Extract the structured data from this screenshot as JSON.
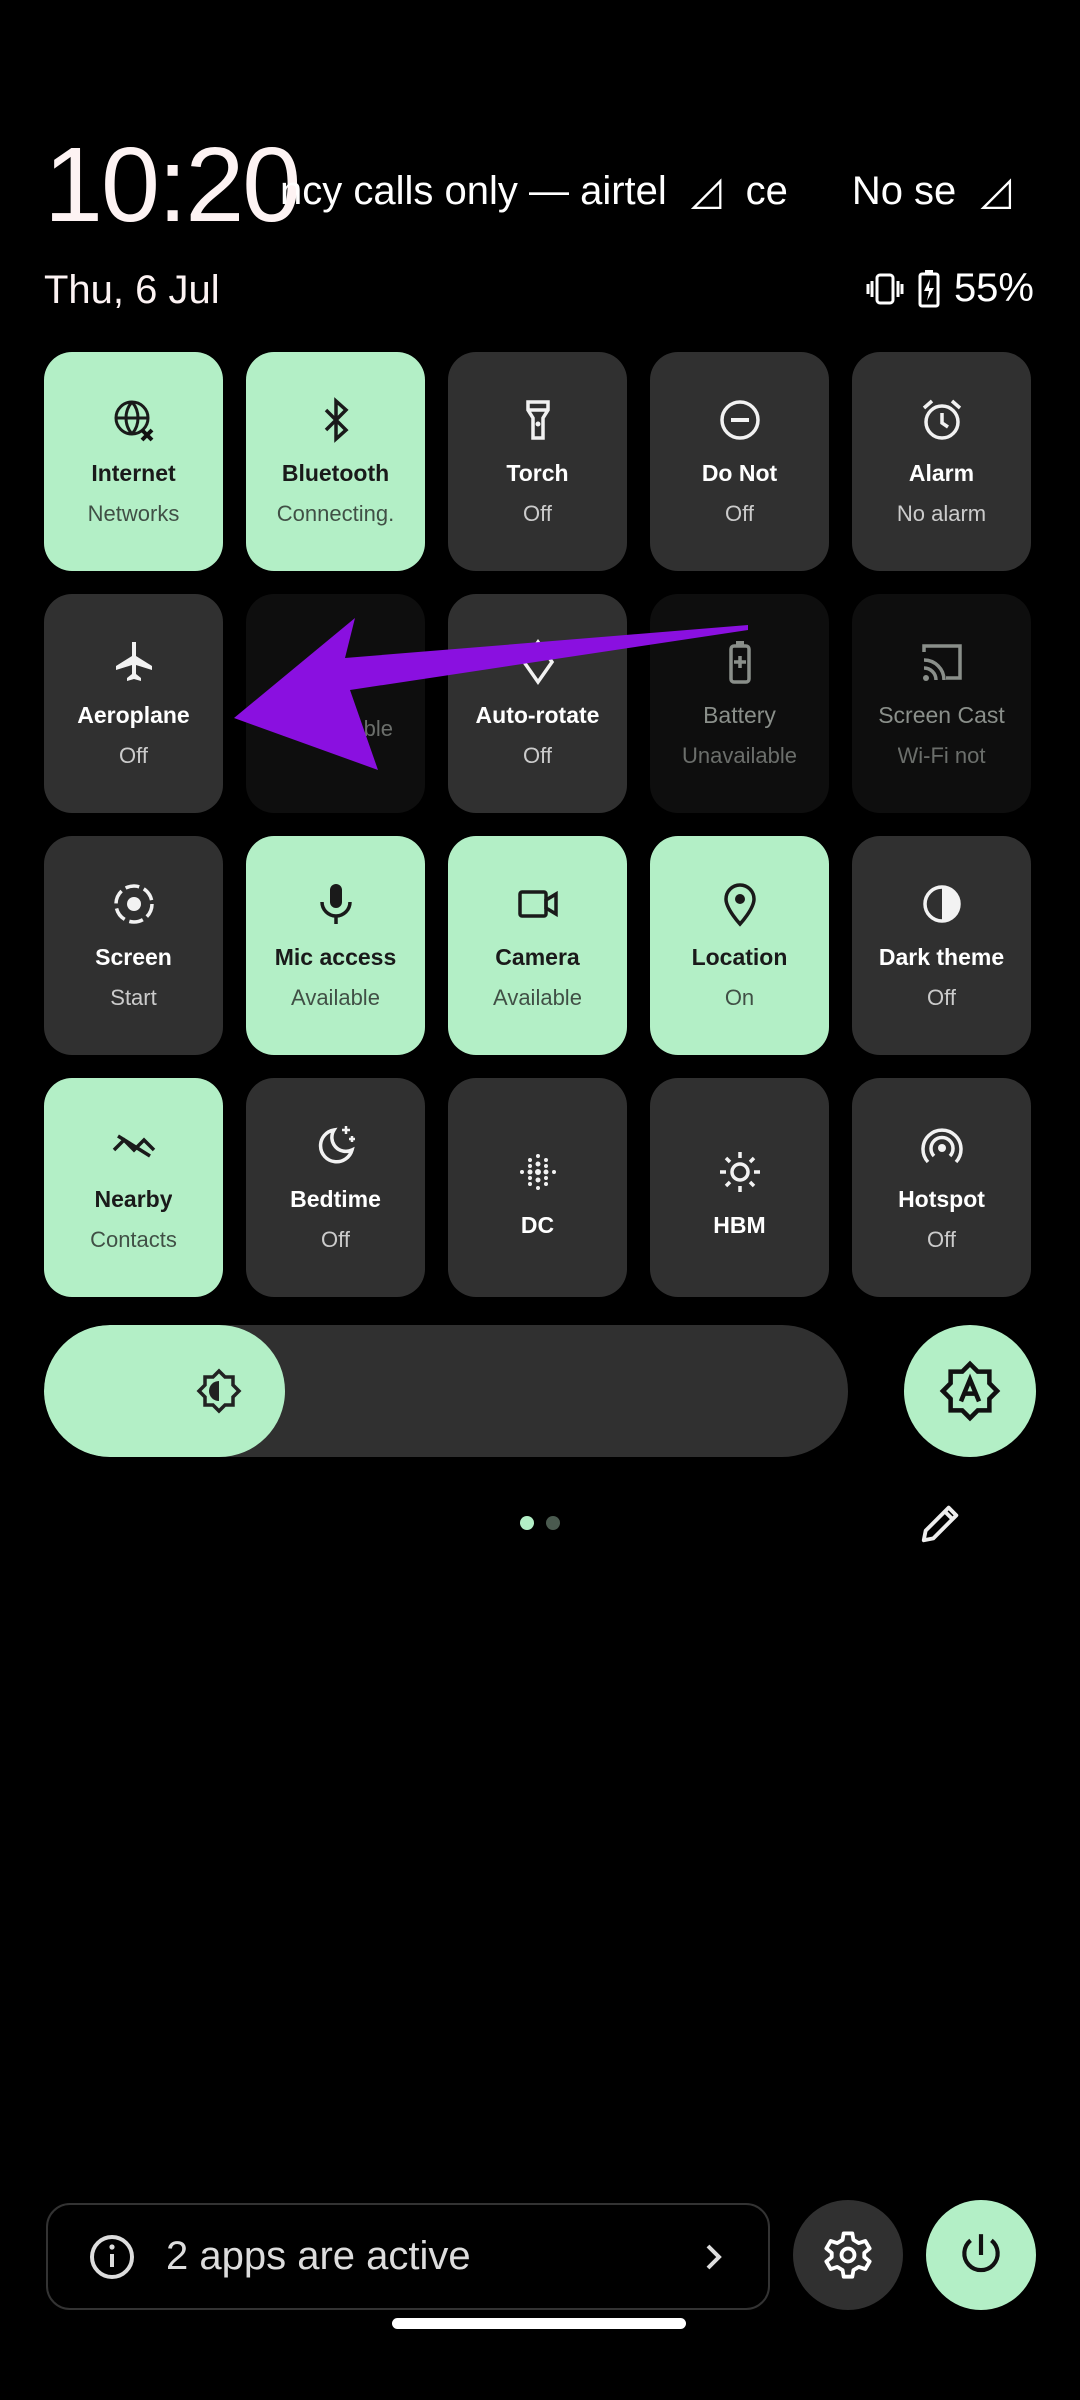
{
  "status": {
    "time": "10:20",
    "carrier_segments": [
      "ncy calls only — airtel",
      "ce",
      "No se"
    ],
    "date": "Thu, 6 Jul",
    "battery": "55%",
    "icons": [
      "signal-alert-icon",
      "vibrate-icon",
      "battery-charging-icon"
    ]
  },
  "tiles": [
    {
      "label": "Internet",
      "sub": "Networks",
      "state": "on",
      "icon": "globe-x-icon"
    },
    {
      "label": "Bluetooth",
      "sub": "Connecting.",
      "state": "on",
      "icon": "bluetooth-icon"
    },
    {
      "label": "Torch",
      "sub": "Off",
      "state": "off",
      "icon": "torch-icon"
    },
    {
      "label": "Do Not",
      "sub": "Off",
      "state": "off",
      "icon": "do-not-disturb-icon"
    },
    {
      "label": "Alarm",
      "sub": "No alarm",
      "state": "off",
      "icon": "alarm-icon"
    },
    {
      "label": "Aeroplane",
      "sub": "Off",
      "state": "off",
      "icon": "airplane-icon"
    },
    {
      "label": "",
      "sub": "Unavailable",
      "state": "unavailable",
      "icon": ""
    },
    {
      "label": "Auto-rotate",
      "sub": "Off",
      "state": "off",
      "icon": "auto-rotate-icon"
    },
    {
      "label": "Battery",
      "sub": "Unavailable",
      "state": "unavailable",
      "icon": "battery-saver-icon"
    },
    {
      "label": "Screen Cast",
      "sub": "Wi-Fi not",
      "state": "unavailable",
      "icon": "cast-icon"
    },
    {
      "label": "Screen",
      "sub": "Start",
      "state": "off",
      "icon": "screen-record-icon"
    },
    {
      "label": "Mic access",
      "sub": "Available",
      "state": "on",
      "icon": "mic-icon"
    },
    {
      "label": "Camera",
      "sub": "Available",
      "state": "on",
      "icon": "camera-icon"
    },
    {
      "label": "Location",
      "sub": "On",
      "state": "on",
      "icon": "location-icon"
    },
    {
      "label": "Dark theme",
      "sub": "Off",
      "state": "off",
      "icon": "dark-theme-icon"
    },
    {
      "label": "Nearby",
      "sub": "Contacts",
      "state": "on",
      "icon": "nearby-share-icon"
    },
    {
      "label": "Bedtime",
      "sub": "Off",
      "state": "off",
      "icon": "bedtime-icon"
    },
    {
      "label": "DC",
      "sub": "",
      "state": "off",
      "icon": "dc-dimming-icon"
    },
    {
      "label": "HBM",
      "sub": "",
      "state": "off",
      "icon": "brightness-icon"
    },
    {
      "label": "Hotspot",
      "sub": "Off",
      "state": "off",
      "icon": "hotspot-icon"
    }
  ],
  "brightness": {
    "level_percent": 30,
    "auto": true
  },
  "pager": {
    "pages": 2,
    "current": 1
  },
  "footer": {
    "active_apps": "2 apps are active"
  },
  "colors": {
    "accent": "#b3efc6",
    "tile_off": "#303030",
    "tile_unavailable": "#0e0e0e",
    "annotation_arrow": "#8a10e0"
  }
}
